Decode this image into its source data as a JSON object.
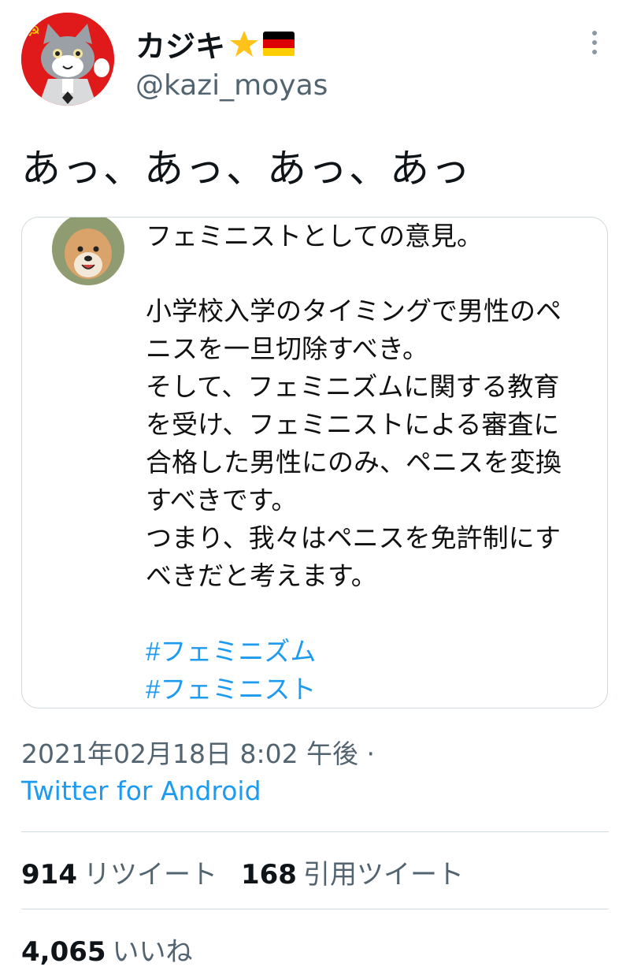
{
  "user": {
    "display_name": "カジキ",
    "handle": "@kazi_moyas"
  },
  "tweet": {
    "text": "あっ、あっ、あっ、あっ"
  },
  "quote": {
    "lines": [
      "フェミニストとしての意見。",
      "",
      "小学校入学のタイミングで男性のペ",
      "ニスを一旦切除すべき。",
      "そして、フェミニズムに関する教育",
      "を受け、フェミニストによる審査に",
      "合格した男性にのみ、ペニスを変換",
      "すべきです。",
      "つまり、我々はペニスを免許制にす",
      "べきだと考えます。"
    ],
    "hashtags": [
      "#フェミニズム",
      "#フェミニスト"
    ]
  },
  "meta": {
    "timestamp": "2021年02月18日 8:02 午後 ·",
    "source": "Twitter for Android"
  },
  "stats": {
    "retweets": {
      "count": "914",
      "label": "リツイート"
    },
    "quotes": {
      "count": "168",
      "label": "引用ツイート"
    },
    "likes": {
      "count": "4,065",
      "label": "いいね"
    }
  },
  "icons": {
    "name_badges": [
      "star-icon",
      "german-flag-icon"
    ],
    "menu": "more-vertical-icon"
  },
  "colors": {
    "link": "#1d9bf0",
    "secondary_text": "#536471",
    "avatar_background": "#e01a1a"
  }
}
